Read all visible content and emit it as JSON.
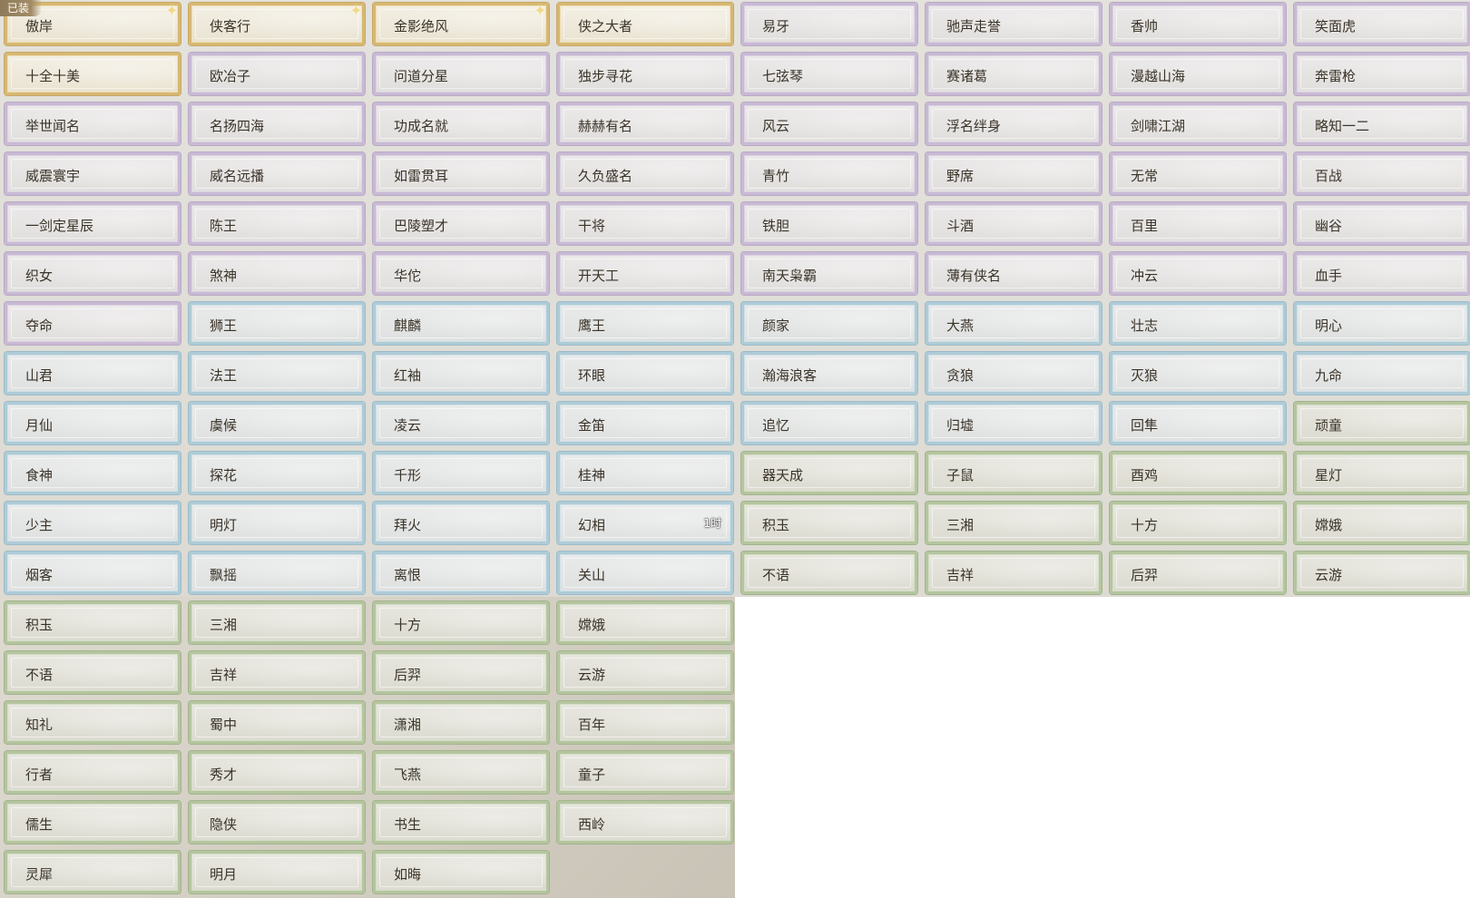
{
  "equipped_badge": "已装",
  "colors": {
    "gold": "#d6b873",
    "purple": "#c8b9d4",
    "blue": "#aecbd7",
    "green": "#b5c59f"
  },
  "titles": [
    {
      "label": "傲岸",
      "rarity": "gold",
      "equipped": true,
      "sparkle": true
    },
    {
      "label": "侠客行",
      "rarity": "gold",
      "sparkle": true
    },
    {
      "label": "金影绝风",
      "rarity": "gold",
      "sparkle": true
    },
    {
      "label": "侠之大者",
      "rarity": "gold"
    },
    {
      "label": "易牙",
      "rarity": "purple"
    },
    {
      "label": "驰声走誉",
      "rarity": "purple"
    },
    {
      "label": "香帅",
      "rarity": "purple"
    },
    {
      "label": "笑面虎",
      "rarity": "purple"
    },
    {
      "label": "十全十美",
      "rarity": "gold"
    },
    {
      "label": "欧冶子",
      "rarity": "purple"
    },
    {
      "label": "问道分星",
      "rarity": "purple"
    },
    {
      "label": "独步寻花",
      "rarity": "purple"
    },
    {
      "label": "七弦琴",
      "rarity": "purple"
    },
    {
      "label": "赛诸葛",
      "rarity": "purple"
    },
    {
      "label": "漫越山海",
      "rarity": "purple"
    },
    {
      "label": "奔雷枪",
      "rarity": "purple"
    },
    {
      "label": "举世闻名",
      "rarity": "purple"
    },
    {
      "label": "名扬四海",
      "rarity": "purple"
    },
    {
      "label": "功成名就",
      "rarity": "purple"
    },
    {
      "label": "赫赫有名",
      "rarity": "purple"
    },
    {
      "label": "风云",
      "rarity": "purple"
    },
    {
      "label": "浮名绊身",
      "rarity": "purple"
    },
    {
      "label": "剑啸江湖",
      "rarity": "purple"
    },
    {
      "label": "略知一二",
      "rarity": "purple"
    },
    {
      "label": "威震寰宇",
      "rarity": "purple"
    },
    {
      "label": "威名远播",
      "rarity": "purple"
    },
    {
      "label": "如雷贯耳",
      "rarity": "purple"
    },
    {
      "label": "久负盛名",
      "rarity": "purple"
    },
    {
      "label": "青竹",
      "rarity": "purple"
    },
    {
      "label": "野席",
      "rarity": "purple"
    },
    {
      "label": "无常",
      "rarity": "purple"
    },
    {
      "label": "百战",
      "rarity": "purple"
    },
    {
      "label": "一剑定星辰",
      "rarity": "purple"
    },
    {
      "label": "陈王",
      "rarity": "purple"
    },
    {
      "label": "巴陵塑才",
      "rarity": "purple"
    },
    {
      "label": "干将",
      "rarity": "purple"
    },
    {
      "label": "铁胆",
      "rarity": "purple"
    },
    {
      "label": "斗酒",
      "rarity": "purple"
    },
    {
      "label": "百里",
      "rarity": "purple"
    },
    {
      "label": "幽谷",
      "rarity": "purple"
    },
    {
      "label": "织女",
      "rarity": "purple"
    },
    {
      "label": "煞神",
      "rarity": "purple"
    },
    {
      "label": "华佗",
      "rarity": "purple"
    },
    {
      "label": "开天工",
      "rarity": "purple"
    },
    {
      "label": "南天枭霸",
      "rarity": "purple"
    },
    {
      "label": "薄有侠名",
      "rarity": "purple"
    },
    {
      "label": "冲云",
      "rarity": "purple"
    },
    {
      "label": "血手",
      "rarity": "purple"
    },
    {
      "label": "夺命",
      "rarity": "purple"
    },
    {
      "label": "狮王",
      "rarity": "blue"
    },
    {
      "label": "麒麟",
      "rarity": "blue"
    },
    {
      "label": "鹰王",
      "rarity": "blue"
    },
    {
      "label": "颜家",
      "rarity": "blue"
    },
    {
      "label": "大燕",
      "rarity": "blue"
    },
    {
      "label": "壮志",
      "rarity": "blue"
    },
    {
      "label": "明心",
      "rarity": "blue"
    },
    {
      "label": "山君",
      "rarity": "blue"
    },
    {
      "label": "法王",
      "rarity": "blue"
    },
    {
      "label": "红袖",
      "rarity": "blue"
    },
    {
      "label": "环眼",
      "rarity": "blue"
    },
    {
      "label": "瀚海浪客",
      "rarity": "blue"
    },
    {
      "label": "贪狼",
      "rarity": "blue"
    },
    {
      "label": "灭狼",
      "rarity": "blue"
    },
    {
      "label": "九命",
      "rarity": "blue"
    },
    {
      "label": "月仙",
      "rarity": "blue"
    },
    {
      "label": "虞候",
      "rarity": "blue"
    },
    {
      "label": "凌云",
      "rarity": "blue"
    },
    {
      "label": "金笛",
      "rarity": "blue"
    },
    {
      "label": "追忆",
      "rarity": "blue"
    },
    {
      "label": "归墟",
      "rarity": "blue"
    },
    {
      "label": "回隼",
      "rarity": "blue"
    },
    {
      "label": "顽童",
      "rarity": "green"
    },
    {
      "label": "食神",
      "rarity": "blue"
    },
    {
      "label": "探花",
      "rarity": "blue"
    },
    {
      "label": "千形",
      "rarity": "blue"
    },
    {
      "label": "桂神",
      "rarity": "blue"
    },
    {
      "label": "器天成",
      "rarity": "green"
    },
    {
      "label": "子鼠",
      "rarity": "green"
    },
    {
      "label": "酉鸡",
      "rarity": "green"
    },
    {
      "label": "星灯",
      "rarity": "green"
    },
    {
      "label": "少主",
      "rarity": "blue"
    },
    {
      "label": "明灯",
      "rarity": "blue"
    },
    {
      "label": "拜火",
      "rarity": "blue"
    },
    {
      "label": "幻相",
      "rarity": "blue",
      "timer": "1时"
    },
    {
      "label": "积玉",
      "rarity": "green"
    },
    {
      "label": "三湘",
      "rarity": "green"
    },
    {
      "label": "十方",
      "rarity": "green"
    },
    {
      "label": "嫦娥",
      "rarity": "green"
    },
    {
      "label": "烟客",
      "rarity": "blue"
    },
    {
      "label": "飘摇",
      "rarity": "blue"
    },
    {
      "label": "离恨",
      "rarity": "blue"
    },
    {
      "label": "关山",
      "rarity": "blue"
    },
    {
      "label": "不语",
      "rarity": "green"
    },
    {
      "label": "吉祥",
      "rarity": "green"
    },
    {
      "label": "后羿",
      "rarity": "green"
    },
    {
      "label": "云游",
      "rarity": "green"
    },
    {
      "label": "积玉",
      "rarity": "green"
    },
    {
      "label": "三湘",
      "rarity": "green"
    },
    {
      "label": "十方",
      "rarity": "green"
    },
    {
      "label": "嫦娥",
      "rarity": "green"
    },
    {
      "label": "不语",
      "rarity": "green"
    },
    {
      "label": "吉祥",
      "rarity": "green"
    },
    {
      "label": "后羿",
      "rarity": "green"
    },
    {
      "label": "云游",
      "rarity": "green"
    },
    {
      "label": "知礼",
      "rarity": "green"
    },
    {
      "label": "蜀中",
      "rarity": "green"
    },
    {
      "label": "潇湘",
      "rarity": "green"
    },
    {
      "label": "百年",
      "rarity": "green"
    },
    {
      "label": "行者",
      "rarity": "green"
    },
    {
      "label": "秀才",
      "rarity": "green"
    },
    {
      "label": "飞燕",
      "rarity": "green"
    },
    {
      "label": "童子",
      "rarity": "green"
    },
    {
      "label": "儒生",
      "rarity": "green"
    },
    {
      "label": "隐侠",
      "rarity": "green"
    },
    {
      "label": "书生",
      "rarity": "green"
    },
    {
      "label": "西岭",
      "rarity": "green"
    },
    {
      "label": "灵犀",
      "rarity": "green"
    },
    {
      "label": "明月",
      "rarity": "green"
    },
    {
      "label": "如晦",
      "rarity": "green"
    }
  ]
}
